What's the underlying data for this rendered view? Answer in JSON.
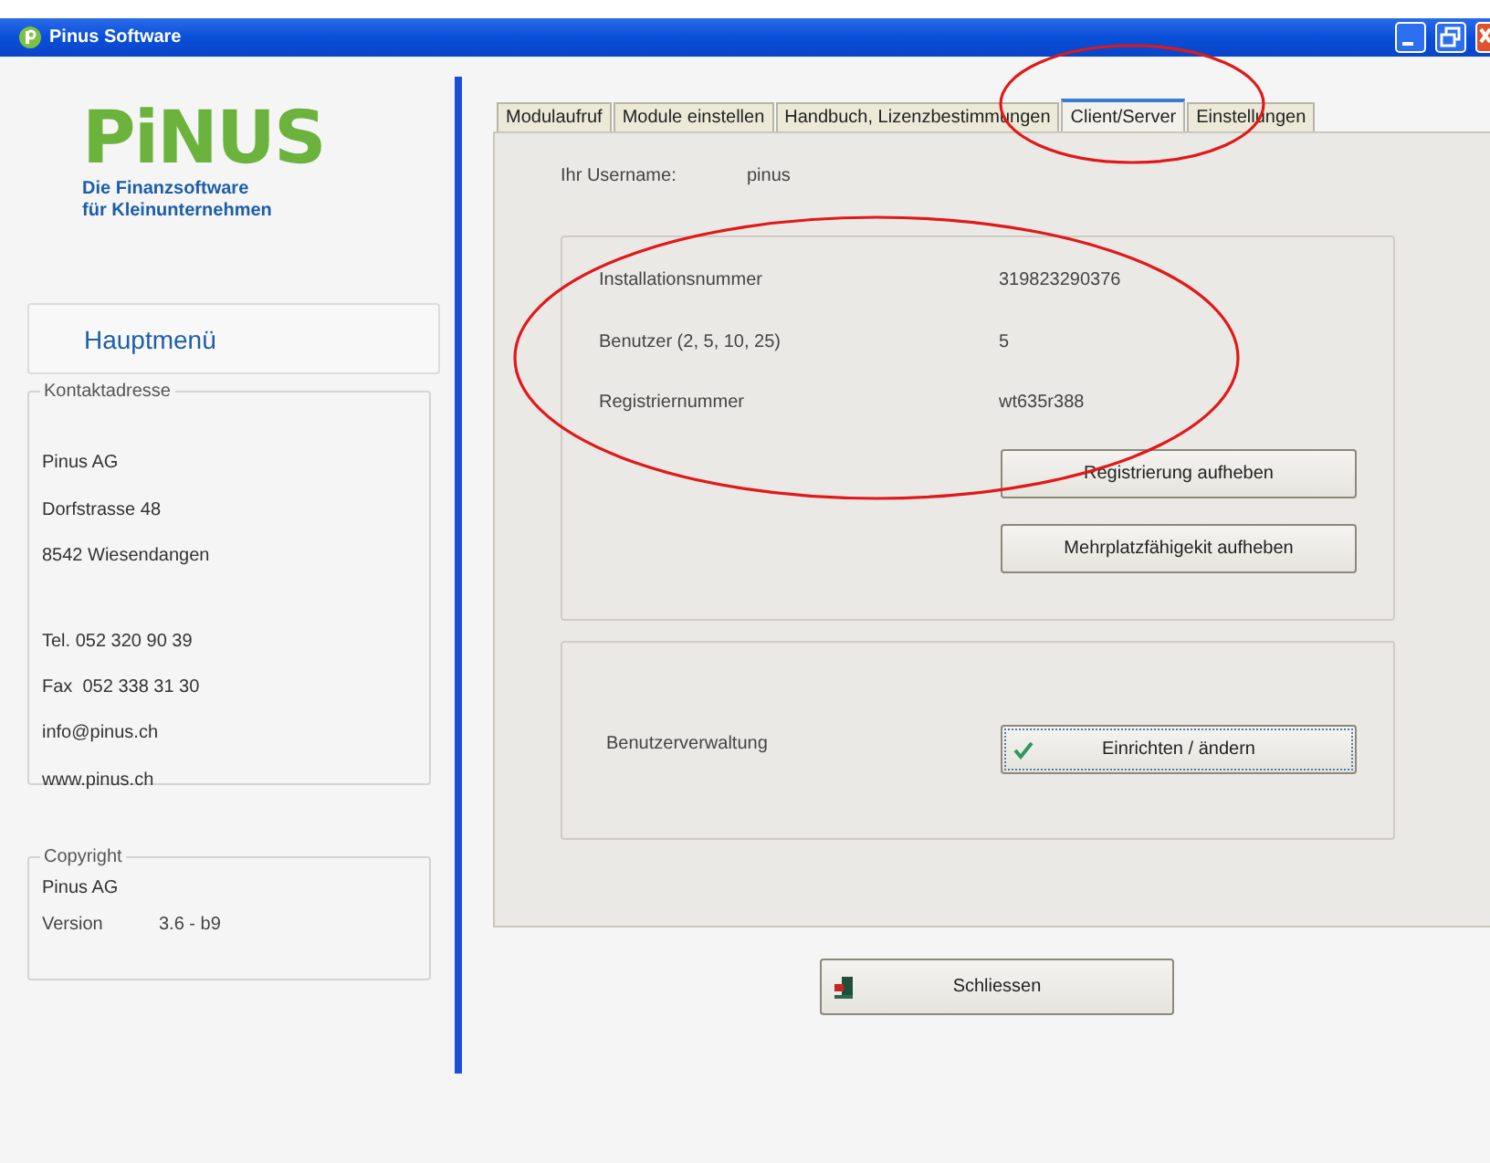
{
  "window": {
    "title": "Pinus Software"
  },
  "sidebar": {
    "logo": {
      "wordmark": "PiNUS",
      "tagline": [
        "Die Finanzsoftware",
        "für Kleinunternehmen"
      ]
    },
    "main_menu": "Hauptmenü",
    "contact": {
      "legend": "Kontaktadresse",
      "lines": [
        {
          "text": "Pinus AG",
          "gap_before": false
        },
        {
          "text": "Dorfstrasse 48",
          "gap_before": false
        },
        {
          "text": "8542 Wiesendangen",
          "gap_before": false
        },
        {
          "text": "Tel. 052 320 90 39",
          "gap_before": true
        },
        {
          "text": "Fax  052 338 31 30",
          "gap_before": false
        },
        {
          "text": "info@pinus.ch",
          "gap_before": false
        },
        {
          "text": "www.pinus.ch",
          "gap_before": false
        }
      ]
    },
    "copyright": {
      "legend": "Copyright",
      "company": "Pinus AG",
      "version_label": "Version",
      "version": "3.6 - b9"
    }
  },
  "tabs": [
    {
      "label": "Modulaufruf",
      "selected": false
    },
    {
      "label": "Module einstellen",
      "selected": false
    },
    {
      "label": "Handbuch, Lizenzbestimmungen",
      "selected": false
    },
    {
      "label": "Client/Server",
      "selected": true
    },
    {
      "label": "Einstellungen",
      "selected": false
    }
  ],
  "username": {
    "label": "Ihr Username:",
    "value": "pinus"
  },
  "license": {
    "fields": [
      {
        "label": "Installationsnummer",
        "value": "319823290376"
      },
      {
        "label": "Benutzer (2, 5, 10, 25)",
        "value": "5"
      },
      {
        "label": "Registriernummer",
        "value": "wt635r388"
      }
    ],
    "buttons": [
      "Registrierung aufheben",
      "Mehrplatzfähigekit aufheben"
    ]
  },
  "user_admin": {
    "label": "Benutzerverwaltung",
    "button": "Einrichten / ändern"
  },
  "close_button": "Schliessen"
}
